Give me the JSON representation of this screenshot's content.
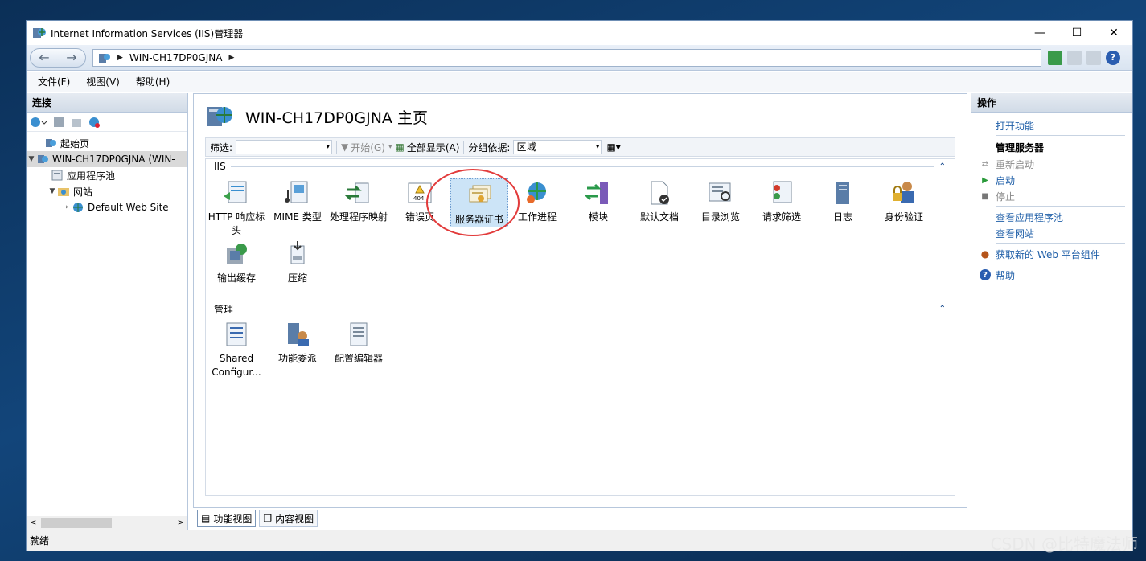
{
  "window": {
    "title": "Internet Information Services (IIS)管理器"
  },
  "address": {
    "path": "WIN-CH17DP0GJNA"
  },
  "menu": {
    "items": [
      "文件(F)",
      "视图(V)",
      "帮助(H)"
    ]
  },
  "connections": {
    "header": "连接",
    "tree": {
      "start_page": "起始页",
      "server": "WIN-CH17DP0GJNA (WIN-",
      "app_pools": "应用程序池",
      "sites": "网站",
      "default_site": "Default Web Site"
    }
  },
  "center": {
    "title": "WIN-CH17DP0GJNA 主页",
    "filter": {
      "label": "筛选:",
      "go": "开始(G)",
      "show_all": "全部显示(A)",
      "group_by_label": "分组依据:",
      "group_by_value": "区域"
    },
    "groups": {
      "iis": "IIS",
      "management": "管理"
    },
    "iis_features": [
      {
        "label": "HTTP 响应标头"
      },
      {
        "label": "MIME 类型"
      },
      {
        "label": "处理程序映射"
      },
      {
        "label": "错误页"
      },
      {
        "label": "服务器证书"
      },
      {
        "label": "工作进程"
      },
      {
        "label": "模块"
      },
      {
        "label": "默认文档"
      },
      {
        "label": "目录浏览"
      },
      {
        "label": "请求筛选"
      },
      {
        "label": "日志"
      },
      {
        "label": "身份验证"
      },
      {
        "label": "输出缓存"
      },
      {
        "label": "压缩"
      }
    ],
    "management_features": [
      {
        "label": "Shared Configur..."
      },
      {
        "label": "功能委派"
      },
      {
        "label": "配置编辑器"
      }
    ],
    "selected_feature": "服务器证书",
    "tabs": {
      "features_view": "功能视图",
      "content_view": "内容视图"
    }
  },
  "actions": {
    "header": "操作",
    "open_feature": "打开功能",
    "manage_server_header": "管理服务器",
    "restart": "重新启动",
    "start": "启动",
    "stop": "停止",
    "view_app_pools": "查看应用程序池",
    "view_sites": "查看网站",
    "get_web_platform": "获取新的 Web 平台组件",
    "help": "帮助"
  },
  "status": {
    "text": "就绪"
  },
  "watermark": "CSDN @比特魔法师",
  "colors": {
    "link": "#1f5fa8",
    "selection": "#cce4f7",
    "highlight_circle": "#e23b3b"
  }
}
